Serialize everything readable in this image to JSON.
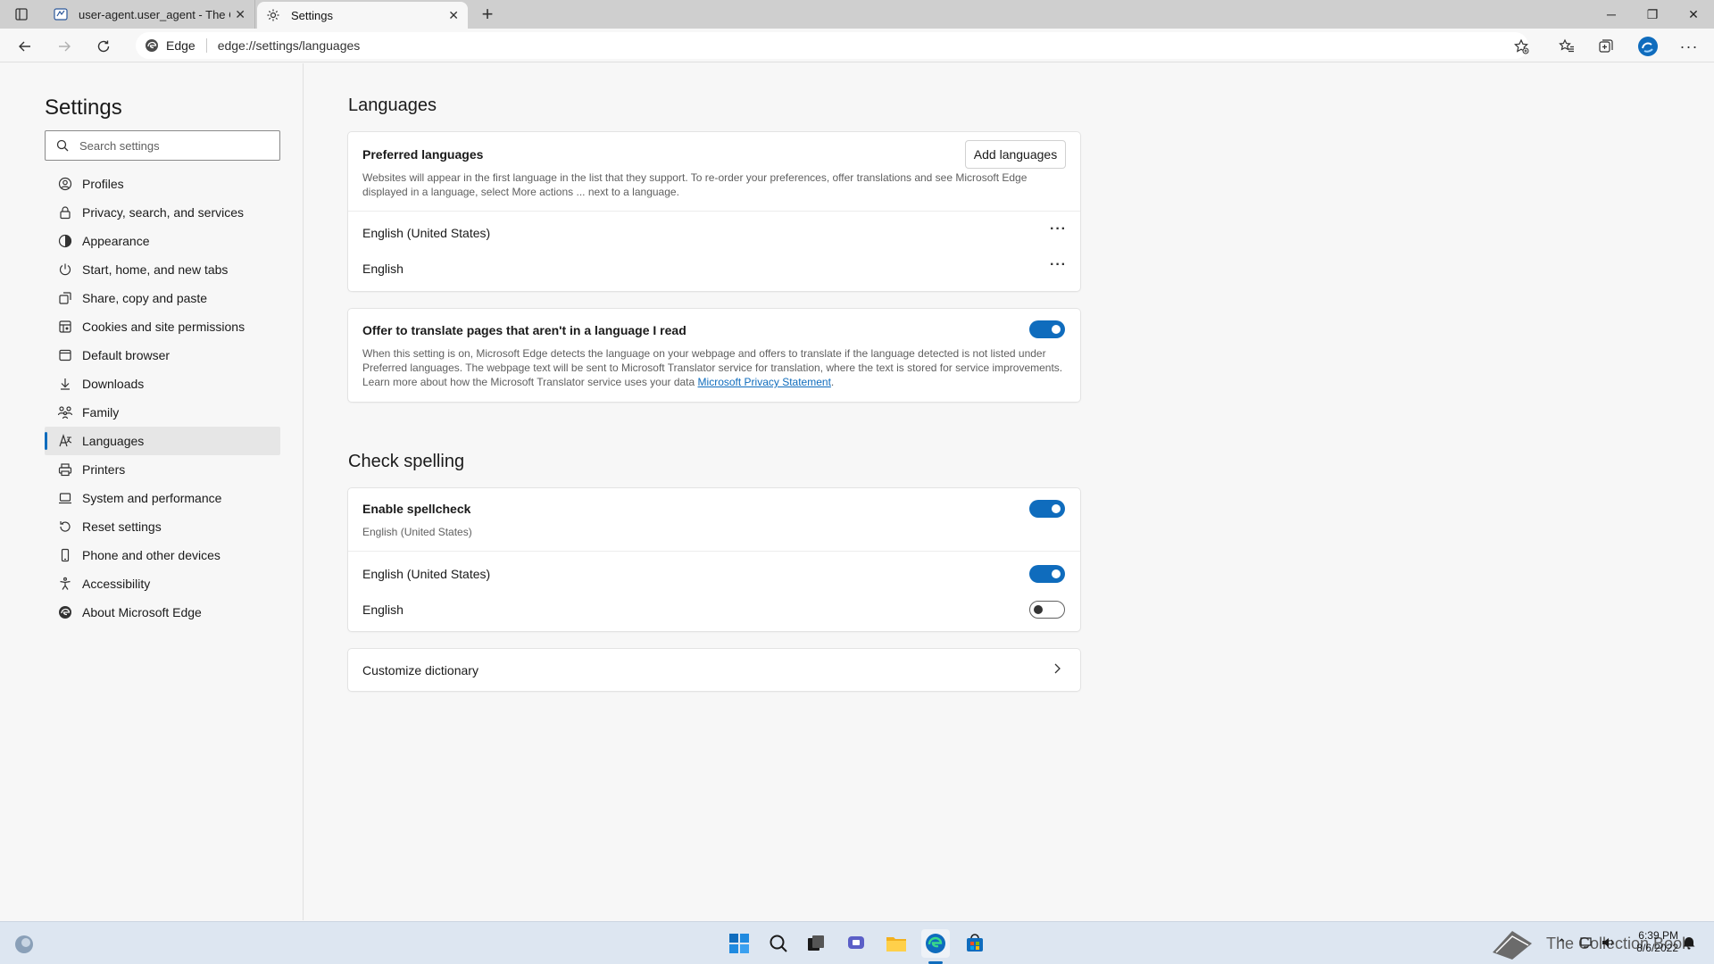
{
  "browser": {
    "tabs": [
      {
        "title": "user-agent.user_agent - The Coll",
        "active": false
      },
      {
        "title": "Settings",
        "active": true
      }
    ],
    "new_tab_symbol": "+",
    "address": {
      "chip": "Edge",
      "url": "edge://settings/languages"
    }
  },
  "sidebar": {
    "title": "Settings",
    "search_placeholder": "Search settings",
    "items": [
      {
        "label": "Profiles",
        "icon": "profile-icon"
      },
      {
        "label": "Privacy, search, and services",
        "icon": "lock-icon"
      },
      {
        "label": "Appearance",
        "icon": "appearance-icon"
      },
      {
        "label": "Start, home, and new tabs",
        "icon": "power-icon"
      },
      {
        "label": "Share, copy and paste",
        "icon": "share-icon"
      },
      {
        "label": "Cookies and site permissions",
        "icon": "cookies-icon"
      },
      {
        "label": "Default browser",
        "icon": "browser-icon"
      },
      {
        "label": "Downloads",
        "icon": "download-icon"
      },
      {
        "label": "Family",
        "icon": "family-icon"
      },
      {
        "label": "Languages",
        "icon": "languages-icon",
        "active": true
      },
      {
        "label": "Printers",
        "icon": "printer-icon"
      },
      {
        "label": "System and performance",
        "icon": "laptop-icon"
      },
      {
        "label": "Reset settings",
        "icon": "reset-icon"
      },
      {
        "label": "Phone and other devices",
        "icon": "phone-icon"
      },
      {
        "label": "Accessibility",
        "icon": "accessibility-icon"
      },
      {
        "label": "About Microsoft Edge",
        "icon": "edge-icon"
      }
    ]
  },
  "languages": {
    "heading": "Languages",
    "preferred": {
      "title": "Preferred languages",
      "add_button": "Add languages",
      "description": "Websites will appear in the first language in the list that they support. To re-order your preferences, offer translations and see Microsoft Edge displayed in a language, select More actions ... next to a language.",
      "items": [
        "English (United States)",
        "English"
      ],
      "more_actions": "···"
    },
    "translate": {
      "title": "Offer to translate pages that aren't in a language I read",
      "enabled": true,
      "description": "When this setting is on, Microsoft Edge detects the language on your webpage and offers to translate if the language detected is not listed under Preferred languages. The webpage text will be sent to Microsoft Translator service for translation, where the text is stored for service improvements. Learn more about how the Microsoft Translator service uses your data",
      "link": "Microsoft Privacy Statement",
      "period": "."
    }
  },
  "spelling": {
    "heading": "Check spelling",
    "enable": {
      "title": "Enable spellcheck",
      "subtitle": "English (United States)",
      "enabled": true
    },
    "languages": [
      {
        "label": "English (United States)",
        "enabled": true
      },
      {
        "label": "English",
        "enabled": false
      }
    ],
    "customize": {
      "label": "Customize dictionary"
    }
  },
  "taskbar": {
    "apps": [
      "start-icon",
      "search-icon",
      "task-view-icon",
      "chat-icon",
      "file-explorer-icon",
      "edge-icon",
      "store-icon"
    ],
    "watermark": "The Collection Book",
    "time": "6:39 PM",
    "date": "8/6/2022"
  },
  "colors": {
    "accent": "#0f6cbd",
    "taskbar": "#dde6f1"
  }
}
